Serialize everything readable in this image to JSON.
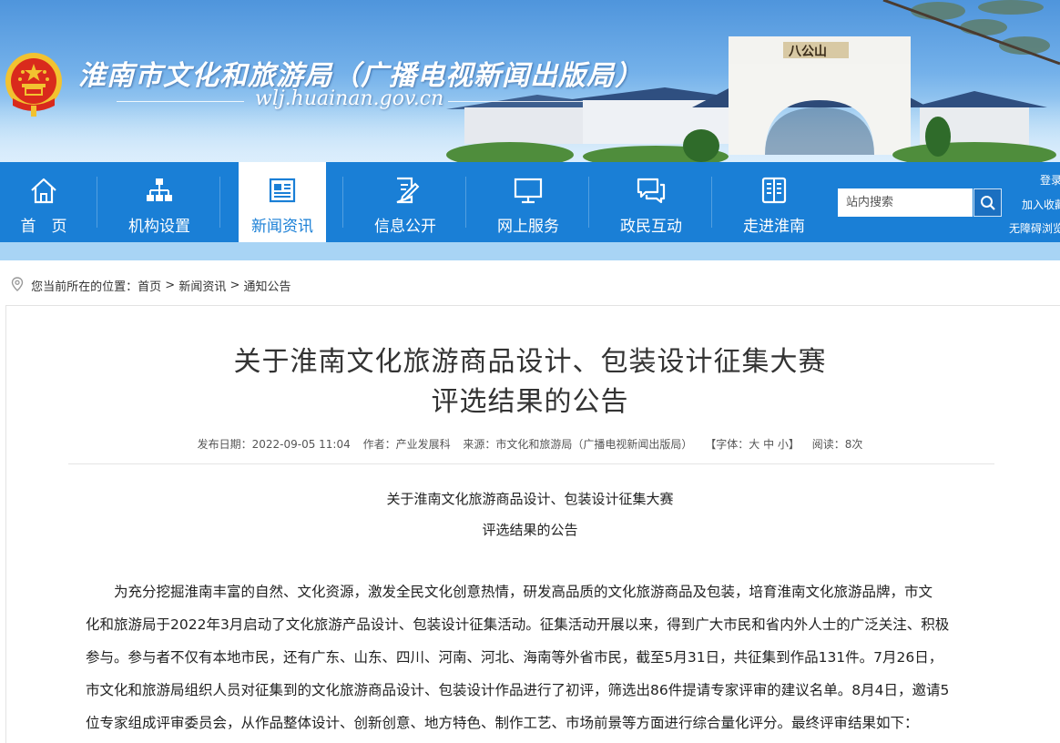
{
  "header": {
    "site_title": "淮南市文化和旅游局（广播电视新闻出版局）",
    "site_url": "wlj.huainan.gov.cn",
    "scene_sign": "八公山"
  },
  "nav": {
    "items": [
      {
        "label": "首　页",
        "icon": "home-icon"
      },
      {
        "label": "机构设置",
        "icon": "org-chart-icon"
      },
      {
        "label": "新闻资讯",
        "icon": "newspaper-icon"
      },
      {
        "label": "信息公开",
        "icon": "document-edit-icon"
      },
      {
        "label": "网上服务",
        "icon": "monitor-icon"
      },
      {
        "label": "政民互动",
        "icon": "chat-bubbles-icon"
      },
      {
        "label": "走进淮南",
        "icon": "book-icon"
      }
    ],
    "search_placeholder": "站内搜索",
    "links": [
      "登录",
      "加入收藏",
      "无障碍浏览"
    ]
  },
  "breadcrumb": {
    "prefix": "您当前所在的位置：",
    "items": [
      "首页",
      "新闻资讯",
      "通知公告"
    ],
    "sep": " > "
  },
  "article": {
    "title_line1": "关于淮南文化旅游商品设计、包装设计征集大赛",
    "title_line2": "评选结果的公告",
    "meta": {
      "date": "发布日期：2022-09-05 11:04",
      "author": "作者：产业发展科",
      "source": "来源：市文化和旅游局（广播电视新闻出版局）",
      "font": "【字体：大 中 小】",
      "views": "阅读：8次"
    },
    "sub_title_line1": "关于淮南文化旅游商品设计、包装设计征集大赛",
    "sub_title_line2": "评选结果的公告",
    "body_lines": [
      "　　为充分挖掘淮南丰富的自然、文化资源，激发全民文化创意热情，研发高品质的文化旅游商品及包装，培育淮南文化旅游品牌，市文",
      "化和旅游局于2022年3月启动了文化旅游产品设计、包装设计征集活动。征集活动开展以来，得到广大市民和省内外人士的广泛关注、积极",
      "参与。参与者不仅有本地市民，还有广东、山东、四川、河南、河北、海南等外省市民，截至5月31日，共征集到作品131件。7月26日，",
      "市文化和旅游局组织人员对征集到的文化旅游商品设计、包装设计作品进行了初评，筛选出86件提请专家评审的建议名单。8月4日，邀请5",
      "位专家组成评审委员会，从作品整体设计、创新创意、地方特色、制作工艺、市场前景等方面进行综合量化评分。最终评审结果如下："
    ]
  },
  "colors": {
    "nav_blue": "#1a7fd6",
    "strip_blue": "#a8d4f5",
    "emblem_red": "#d92a1c",
    "emblem_gold": "#f2c230"
  }
}
